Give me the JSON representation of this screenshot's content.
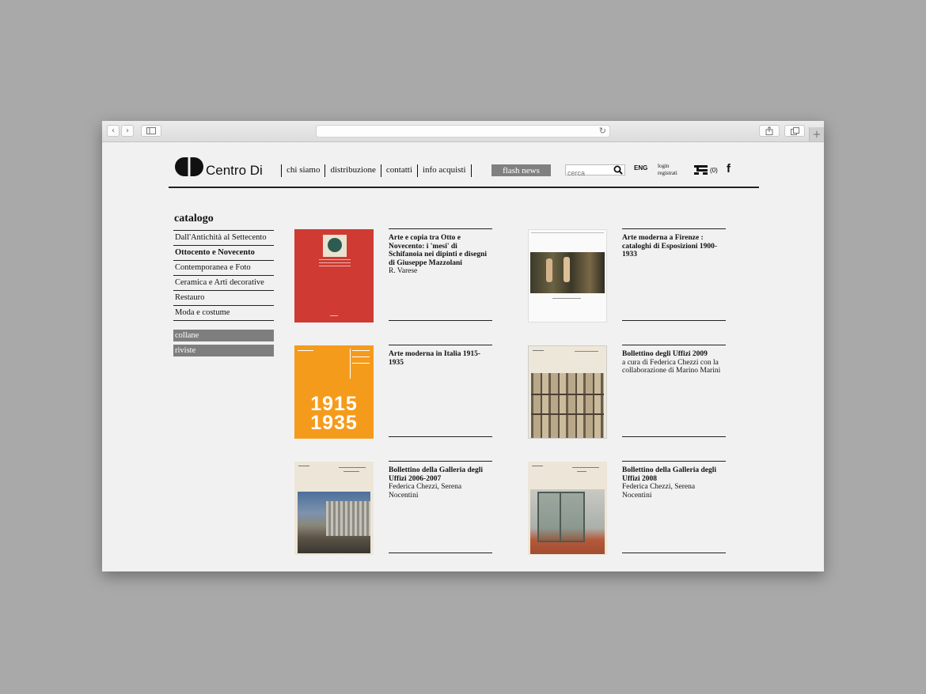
{
  "site": {
    "logo_text": "Centro Di",
    "nav": [
      "chi siamo",
      "distribuzione",
      "contatti",
      "info acquisti"
    ],
    "flash": "flash news",
    "search_placeholder": "cerca",
    "lang": "ENG",
    "login": "login",
    "register": "registrati",
    "cart_count": "(0)",
    "fb": "f"
  },
  "sidebar": {
    "title": "catalogo",
    "items": [
      "Dall'Antichità al Settecento",
      "Ottocento e Novecento",
      "Contemporanea e Foto",
      "Ceramica e Arti decorative",
      "Restauro",
      "Moda e costume"
    ],
    "active_index": 1,
    "collane": "collane",
    "riviste": "riviste"
  },
  "books": [
    {
      "title": "Arte e copia tra Otto e Novecento: i 'mesi' di Schifanoia nei dipinti e disegni di Giuseppe Mazzolani",
      "author": "R. Varese"
    },
    {
      "title": "Arte moderna a Firenze : cataloghi di Esposizioni 1900-1933",
      "author": ""
    },
    {
      "title": "Arte moderna in Italia 1915-1935",
      "author": ""
    },
    {
      "title": "Bollettino degli Uffizi 2009",
      "author": "a cura di Federica Chezzi con la collaborazione di Marino Marini"
    },
    {
      "title": "Bollettino della Galleria degli Uffizi 2006-2007",
      "author": "Federica Chezzi, Serena Nocentini"
    },
    {
      "title": "Bollettino della Galleria degli Uffizi 2008",
      "author": "Federica Chezzi, Serena Nocentini"
    }
  ],
  "cover_text": {
    "c3": [
      "1915",
      "1935"
    ]
  },
  "colors": {
    "cover_red": "#cf3a32",
    "cover_orange": "#f59b1c",
    "flash_bg": "#808080"
  }
}
